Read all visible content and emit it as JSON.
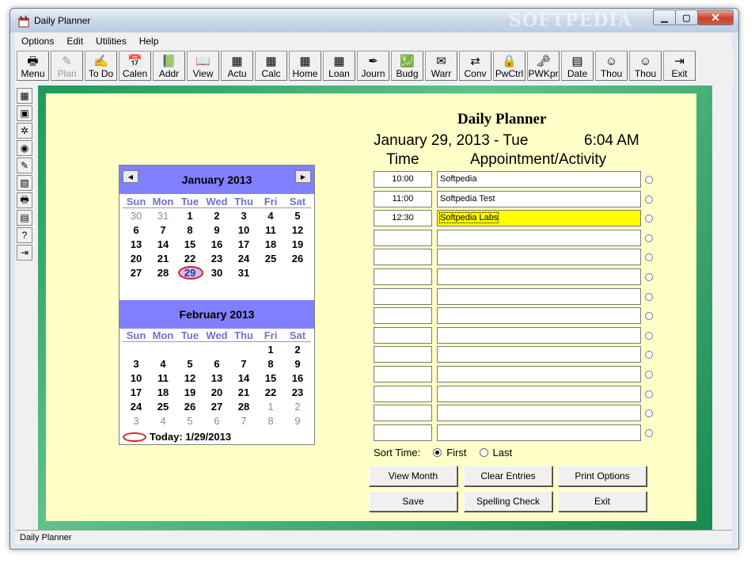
{
  "window": {
    "title": "Daily Planner",
    "watermark": "SOFTPEDIA"
  },
  "menu": [
    "Options",
    "Edit",
    "Utilities",
    "Help"
  ],
  "toolbar": [
    {
      "label": "Menu",
      "icon": "printer-icon",
      "glyph": "🖶"
    },
    {
      "label": "Plan",
      "icon": "pencil-icon",
      "glyph": "✎",
      "disabled": true
    },
    {
      "label": "To Do",
      "icon": "checklist-icon",
      "glyph": "✍"
    },
    {
      "label": "Calen",
      "icon": "calendar-icon",
      "glyph": "📅"
    },
    {
      "label": "Addr",
      "icon": "address-book-icon",
      "glyph": "📗"
    },
    {
      "label": "View",
      "icon": "book-icon",
      "glyph": "📖"
    },
    {
      "label": "Actu",
      "icon": "calculator-icon",
      "glyph": "▦"
    },
    {
      "label": "Calc",
      "icon": "calculator-icon",
      "glyph": "▦"
    },
    {
      "label": "Home",
      "icon": "calculator-icon",
      "glyph": "▦"
    },
    {
      "label": "Loan",
      "icon": "calculator-icon",
      "glyph": "▦"
    },
    {
      "label": "Journ",
      "icon": "journal-icon",
      "glyph": "✒"
    },
    {
      "label": "Budg",
      "icon": "budget-icon",
      "glyph": "💹"
    },
    {
      "label": "Warr",
      "icon": "warranty-icon",
      "glyph": "✉"
    },
    {
      "label": "Conv",
      "icon": "converter-icon",
      "glyph": "⇄"
    },
    {
      "label": "PwCtrl",
      "icon": "password-icon",
      "glyph": "🔒"
    },
    {
      "label": "PWKpr",
      "icon": "keeper-icon",
      "glyph": "🗝"
    },
    {
      "label": "Date",
      "icon": "date-icon",
      "glyph": "▤"
    },
    {
      "label": "Thou",
      "icon": "smiley-icon",
      "glyph": "☺"
    },
    {
      "label": "Thou",
      "icon": "smiley-icon",
      "glyph": "☺"
    },
    {
      "label": "Exit",
      "icon": "exit-icon",
      "glyph": "⇥"
    }
  ],
  "sidebar": [
    {
      "icon": "grid-icon",
      "glyph": "▦"
    },
    {
      "icon": "note-icon",
      "glyph": "▣"
    },
    {
      "icon": "tools-icon",
      "glyph": "✲"
    },
    {
      "icon": "eye-icon",
      "glyph": "◉"
    },
    {
      "icon": "pencil-icon",
      "glyph": "✎"
    },
    {
      "icon": "screen-icon",
      "glyph": "▧"
    },
    {
      "icon": "printer-icon",
      "glyph": "🖶"
    },
    {
      "icon": "calendar-icon",
      "glyph": "▤"
    },
    {
      "icon": "help-icon",
      "glyph": "?"
    },
    {
      "icon": "exit-icon",
      "glyph": "⇥"
    }
  ],
  "calendar": {
    "months": [
      {
        "title": "January 2013",
        "days": [
          {
            "d": "30",
            "o": true
          },
          {
            "d": "31",
            "o": true
          },
          {
            "d": "1"
          },
          {
            "d": "2"
          },
          {
            "d": "3"
          },
          {
            "d": "4"
          },
          {
            "d": "5"
          },
          {
            "d": "6"
          },
          {
            "d": "7"
          },
          {
            "d": "8"
          },
          {
            "d": "9"
          },
          {
            "d": "10"
          },
          {
            "d": "11"
          },
          {
            "d": "12"
          },
          {
            "d": "13"
          },
          {
            "d": "14"
          },
          {
            "d": "15"
          },
          {
            "d": "16"
          },
          {
            "d": "17"
          },
          {
            "d": "18"
          },
          {
            "d": "19"
          },
          {
            "d": "20"
          },
          {
            "d": "21"
          },
          {
            "d": "22"
          },
          {
            "d": "23"
          },
          {
            "d": "24"
          },
          {
            "d": "25"
          },
          {
            "d": "26"
          },
          {
            "d": "27"
          },
          {
            "d": "28"
          },
          {
            "d": "29",
            "t": true
          },
          {
            "d": "30"
          },
          {
            "d": "31"
          }
        ]
      },
      {
        "title": "February 2013",
        "days": [
          {
            "d": ""
          },
          {
            "d": ""
          },
          {
            "d": ""
          },
          {
            "d": ""
          },
          {
            "d": ""
          },
          {
            "d": "1"
          },
          {
            "d": "2"
          },
          {
            "d": "3"
          },
          {
            "d": "4"
          },
          {
            "d": "5"
          },
          {
            "d": "6"
          },
          {
            "d": "7"
          },
          {
            "d": "8"
          },
          {
            "d": "9"
          },
          {
            "d": "10"
          },
          {
            "d": "11"
          },
          {
            "d": "12"
          },
          {
            "d": "13"
          },
          {
            "d": "14"
          },
          {
            "d": "15"
          },
          {
            "d": "16"
          },
          {
            "d": "17"
          },
          {
            "d": "18"
          },
          {
            "d": "19"
          },
          {
            "d": "20"
          },
          {
            "d": "21"
          },
          {
            "d": "22"
          },
          {
            "d": "23"
          },
          {
            "d": "24"
          },
          {
            "d": "25"
          },
          {
            "d": "26"
          },
          {
            "d": "27"
          },
          {
            "d": "28"
          },
          {
            "d": "1",
            "o": true
          },
          {
            "d": "2",
            "o": true
          },
          {
            "d": "3",
            "o": true
          },
          {
            "d": "4",
            "o": true
          },
          {
            "d": "5",
            "o": true
          },
          {
            "d": "6",
            "o": true
          },
          {
            "d": "7",
            "o": true
          },
          {
            "d": "8",
            "o": true
          },
          {
            "d": "9",
            "o": true
          }
        ]
      }
    ],
    "weekdays": [
      "Sun",
      "Mon",
      "Tue",
      "Wed",
      "Thu",
      "Fri",
      "Sat"
    ],
    "today_label": "Today: 1/29/2013"
  },
  "planner": {
    "title": "Daily Planner",
    "date": "January 29, 2013 - Tue",
    "time": "6:04 AM",
    "col_time": "Time",
    "col_activity": "Appointment/Activity",
    "rows": [
      {
        "time": "10:00",
        "activity": "Softpedia"
      },
      {
        "time": "11:00",
        "activity": "Softpedia Test"
      },
      {
        "time": "12:30",
        "activity": "Softpedia Labs",
        "highlight": true
      },
      {
        "time": "",
        "activity": ""
      },
      {
        "time": "",
        "activity": ""
      },
      {
        "time": "",
        "activity": ""
      },
      {
        "time": "",
        "activity": ""
      },
      {
        "time": "",
        "activity": ""
      },
      {
        "time": "",
        "activity": ""
      },
      {
        "time": "",
        "activity": ""
      },
      {
        "time": "",
        "activity": ""
      },
      {
        "time": "",
        "activity": ""
      },
      {
        "time": "",
        "activity": ""
      },
      {
        "time": "",
        "activity": ""
      }
    ],
    "sort_label": "Sort Time:",
    "sort_first": "First",
    "sort_last": "Last"
  },
  "buttons": {
    "view_month": "View Month",
    "clear_entries": "Clear Entries",
    "print_options": "Print Options",
    "save": "Save",
    "spelling_check": "Spelling Check",
    "exit": "Exit"
  },
  "status": "Daily Planner",
  "colors": {
    "panel": "#ffffc8",
    "frame": "#1e9a5a",
    "calendar_header": "#8080ff",
    "highlight": "#ffff00",
    "today_ring": "#e02020"
  }
}
